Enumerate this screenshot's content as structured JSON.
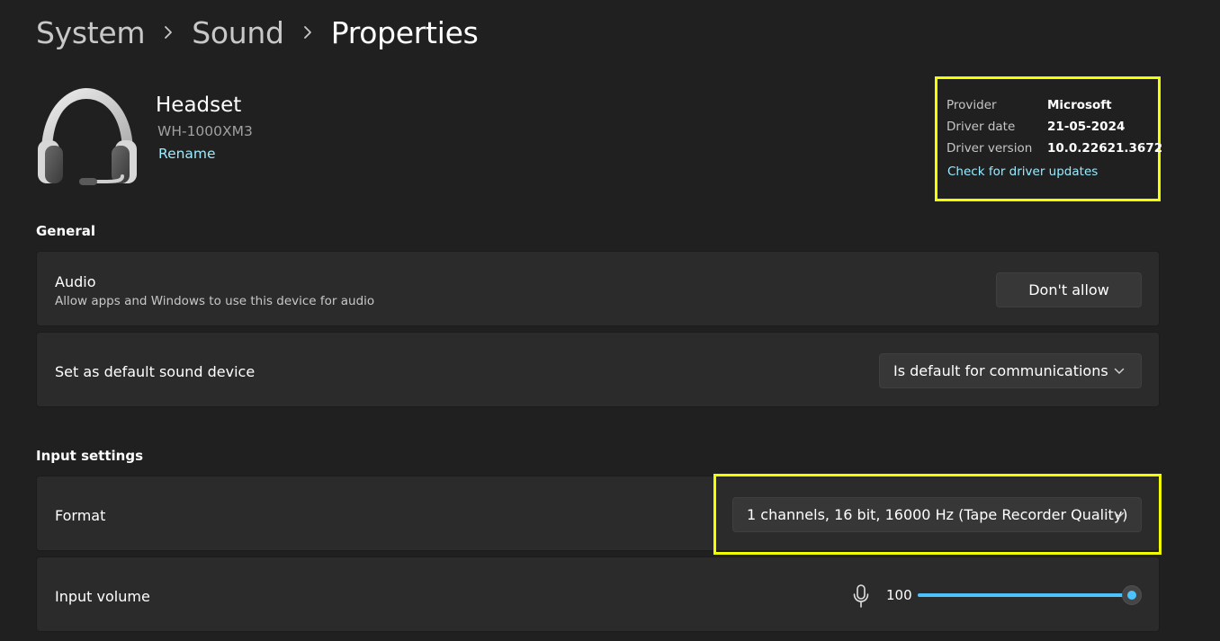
{
  "breadcrumb": {
    "items": [
      "System",
      "Sound",
      "Properties"
    ]
  },
  "device": {
    "name": "Headset",
    "model": "WH-1000XM3",
    "rename_label": "Rename",
    "icon": "headset-icon"
  },
  "driver": {
    "provider_label": "Provider",
    "provider_value": "Microsoft",
    "date_label": "Driver date",
    "date_value": "21-05-2024",
    "version_label": "Driver version",
    "version_value": "10.0.22621.3672",
    "update_link": "Check for driver updates"
  },
  "general": {
    "title": "General",
    "audio": {
      "title": "Audio",
      "subtitle": "Allow apps and Windows to use this device for audio",
      "button_label": "Don't allow"
    },
    "default_device": {
      "title": "Set as default sound device",
      "selected": "Is default for communications"
    }
  },
  "input": {
    "title": "Input settings",
    "format": {
      "title": "Format",
      "selected": "1 channels, 16 bit, 16000 Hz (Tape Recorder Quality)"
    },
    "volume": {
      "title": "Input volume",
      "value": "100",
      "level_percent": 100,
      "icon": "microphone-icon"
    }
  },
  "colors": {
    "background": "#202020",
    "card": "#2b2b2b",
    "accent": "#4cc2ff",
    "link": "#99ebff",
    "highlight": "#f2ff00"
  }
}
